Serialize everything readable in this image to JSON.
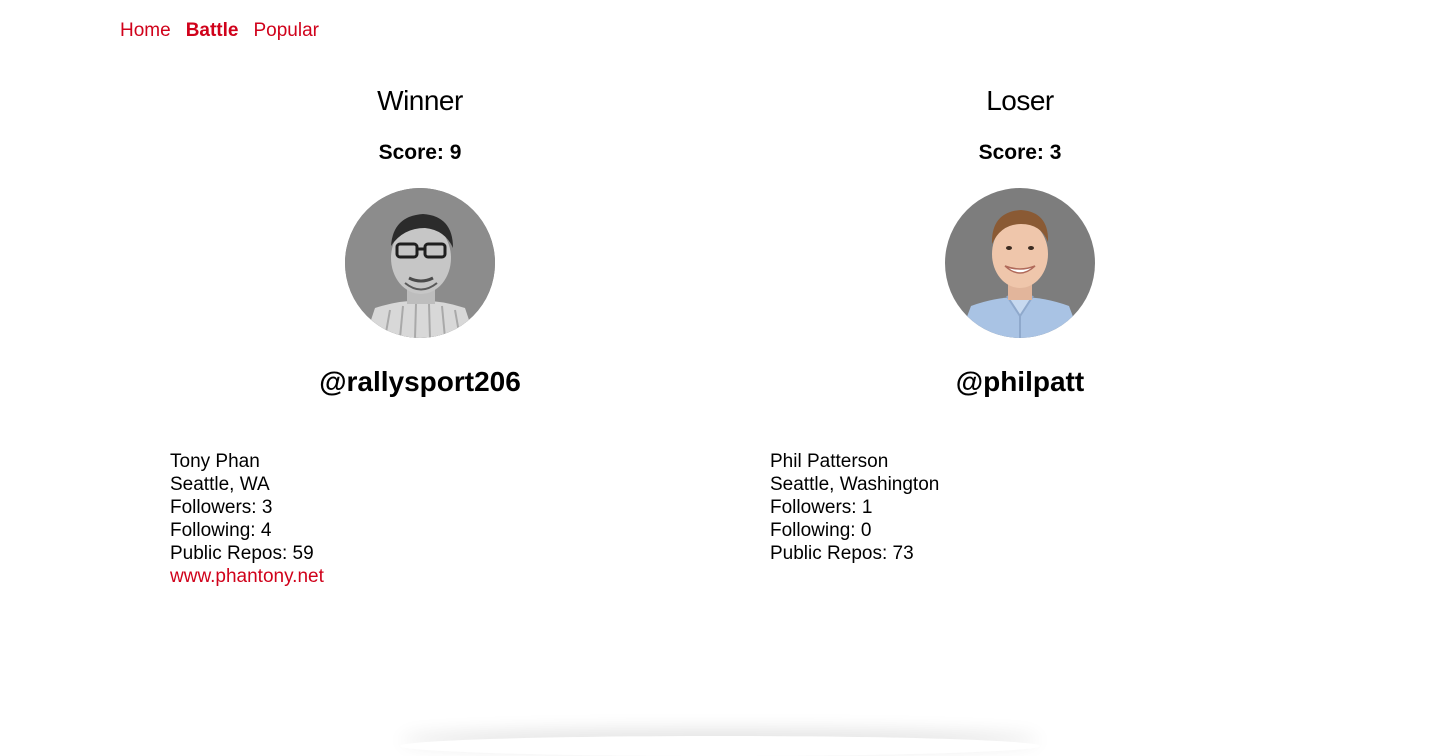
{
  "nav": {
    "items": [
      {
        "label": "Home",
        "active": false
      },
      {
        "label": "Battle",
        "active": true
      },
      {
        "label": "Popular",
        "active": false
      }
    ]
  },
  "players": [
    {
      "result": "Winner",
      "score": "Score: 9",
      "username": "@rallysport206",
      "name": "Tony Phan",
      "location": "Seattle, WA",
      "followers": "Followers: 3",
      "following": "Following: 4",
      "repos": "Public Repos: 59",
      "blog": "www.phantony.net"
    },
    {
      "result": "Loser",
      "score": "Score: 3",
      "username": "@philpatt",
      "name": "Phil Patterson",
      "location": "Seattle, Washington",
      "followers": "Followers: 1",
      "following": "Following: 0",
      "repos": "Public Repos: 73"
    }
  ],
  "colors": {
    "accent": "#d0021b",
    "text": "#000000",
    "background": "#ffffff"
  }
}
